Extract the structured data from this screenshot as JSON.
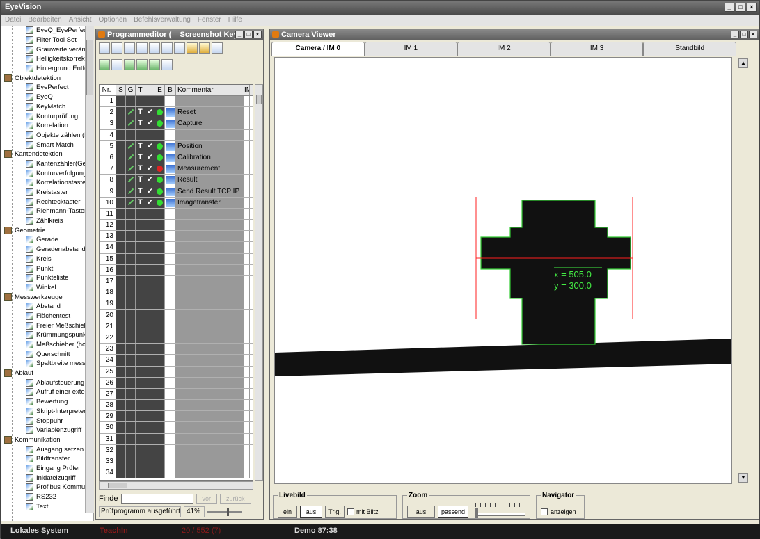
{
  "app": {
    "title": "EyeVision"
  },
  "menu": [
    "Datei",
    "Bearbeiten",
    "Ansicht",
    "Optionen",
    "Befehlsverwaltung",
    "Fenster",
    "Hilfe"
  ],
  "tree": [
    {
      "type": "item",
      "label": "EyeQ_EyePerfect"
    },
    {
      "type": "item",
      "label": "Filter Tool Set"
    },
    {
      "type": "item",
      "label": "Grauwerte veränd"
    },
    {
      "type": "item",
      "label": "Helligkeitskorrekt"
    },
    {
      "type": "item",
      "label": "Hintergrund Entfer"
    },
    {
      "type": "cat",
      "label": "Objektdetektion"
    },
    {
      "type": "item",
      "label": "EyePerfect"
    },
    {
      "type": "item",
      "label": "EyeQ"
    },
    {
      "type": "item",
      "label": "KeyMatch"
    },
    {
      "type": "item",
      "label": "Konturprüfung"
    },
    {
      "type": "item",
      "label": "Korrelation"
    },
    {
      "type": "item",
      "label": "Objekte zählen (B"
    },
    {
      "type": "item",
      "label": "Smart Match"
    },
    {
      "type": "cat",
      "label": "Kantendetektion"
    },
    {
      "type": "item",
      "label": "Kantenzähler(Gera"
    },
    {
      "type": "item",
      "label": "Konturverfolgung"
    },
    {
      "type": "item",
      "label": "Korrelationstaster"
    },
    {
      "type": "item",
      "label": "Kreistaster"
    },
    {
      "type": "item",
      "label": "Rechtecktaster"
    },
    {
      "type": "item",
      "label": "Riehmann-Taster"
    },
    {
      "type": "item",
      "label": "Zählkreis"
    },
    {
      "type": "cat",
      "label": "Geometrie"
    },
    {
      "type": "item",
      "label": "Gerade"
    },
    {
      "type": "item",
      "label": "Geradenabstand"
    },
    {
      "type": "item",
      "label": "Kreis"
    },
    {
      "type": "item",
      "label": "Punkt"
    },
    {
      "type": "item",
      "label": "Punkteliste"
    },
    {
      "type": "item",
      "label": "Winkel"
    },
    {
      "type": "cat",
      "label": "Messwerkzeuge"
    },
    {
      "type": "item",
      "label": "Abstand"
    },
    {
      "type": "item",
      "label": "Flächentest"
    },
    {
      "type": "item",
      "label": "Freier Meßschiebe"
    },
    {
      "type": "item",
      "label": "Krümmungspunkt"
    },
    {
      "type": "item",
      "label": "Meßschieber (hor."
    },
    {
      "type": "item",
      "label": "Querschnitt"
    },
    {
      "type": "item",
      "label": "Spaltbreite messe"
    },
    {
      "type": "cat",
      "label": "Ablauf"
    },
    {
      "type": "item",
      "label": "Ablaufsteuerung"
    },
    {
      "type": "item",
      "label": "Aufruf einer extern"
    },
    {
      "type": "item",
      "label": "Bewertung"
    },
    {
      "type": "item",
      "label": "Skript-Interpreter"
    },
    {
      "type": "item",
      "label": "Stoppuhr"
    },
    {
      "type": "item",
      "label": "Variablenzugriff"
    },
    {
      "type": "cat",
      "label": "Kommunikation"
    },
    {
      "type": "item",
      "label": "Ausgang setzen"
    },
    {
      "type": "item",
      "label": "Bildtransfer"
    },
    {
      "type": "item",
      "label": "Eingang Prüfen"
    },
    {
      "type": "item",
      "label": "Inidateizugriff"
    },
    {
      "type": "item",
      "label": "Profibus Kommuni"
    },
    {
      "type": "item",
      "label": "RS232"
    },
    {
      "type": "item",
      "label": "Text"
    }
  ],
  "program_editor": {
    "title": "Programmeditor (__Screenshot Key...",
    "columns": [
      "Nr.",
      "S",
      "G",
      "T",
      "I",
      "E",
      "B",
      "Kommentar",
      "IM"
    ],
    "rows": [
      {
        "nr": "1",
        "comment": "",
        "active": false,
        "status": ""
      },
      {
        "nr": "2",
        "comment": "Reset",
        "active": true,
        "status": "green"
      },
      {
        "nr": "3",
        "comment": "Capture",
        "active": true,
        "status": "green"
      },
      {
        "nr": "4",
        "comment": "",
        "active": false,
        "status": ""
      },
      {
        "nr": "5",
        "comment": "Position",
        "active": true,
        "status": "green"
      },
      {
        "nr": "6",
        "comment": "Calibration",
        "active": true,
        "status": "green"
      },
      {
        "nr": "7",
        "comment": "Measurement",
        "active": true,
        "status": "red"
      },
      {
        "nr": "8",
        "comment": "Result",
        "active": true,
        "status": "green"
      },
      {
        "nr": "9",
        "comment": "Send Result TCP IP",
        "active": true,
        "status": "green"
      },
      {
        "nr": "10",
        "comment": "Imagetransfer",
        "active": true,
        "status": "green"
      },
      {
        "nr": "11",
        "comment": "",
        "active": false,
        "status": ""
      },
      {
        "nr": "12",
        "comment": "",
        "active": false,
        "status": ""
      },
      {
        "nr": "13",
        "comment": "",
        "active": false,
        "status": ""
      },
      {
        "nr": "14",
        "comment": "",
        "active": false,
        "status": ""
      },
      {
        "nr": "15",
        "comment": "",
        "active": false,
        "status": ""
      },
      {
        "nr": "16",
        "comment": "",
        "active": false,
        "status": ""
      },
      {
        "nr": "17",
        "comment": "",
        "active": false,
        "status": ""
      },
      {
        "nr": "18",
        "comment": "",
        "active": false,
        "status": ""
      },
      {
        "nr": "19",
        "comment": "",
        "active": false,
        "status": ""
      },
      {
        "nr": "20",
        "comment": "",
        "active": false,
        "status": ""
      },
      {
        "nr": "21",
        "comment": "",
        "active": false,
        "status": ""
      },
      {
        "nr": "22",
        "comment": "",
        "active": false,
        "status": ""
      },
      {
        "nr": "23",
        "comment": "",
        "active": false,
        "status": ""
      },
      {
        "nr": "24",
        "comment": "",
        "active": false,
        "status": ""
      },
      {
        "nr": "25",
        "comment": "",
        "active": false,
        "status": ""
      },
      {
        "nr": "26",
        "comment": "",
        "active": false,
        "status": ""
      },
      {
        "nr": "27",
        "comment": "",
        "active": false,
        "status": ""
      },
      {
        "nr": "28",
        "comment": "",
        "active": false,
        "status": ""
      },
      {
        "nr": "29",
        "comment": "",
        "active": false,
        "status": ""
      },
      {
        "nr": "30",
        "comment": "",
        "active": false,
        "status": ""
      },
      {
        "nr": "31",
        "comment": "",
        "active": false,
        "status": ""
      },
      {
        "nr": "32",
        "comment": "",
        "active": false,
        "status": ""
      },
      {
        "nr": "33",
        "comment": "",
        "active": false,
        "status": ""
      },
      {
        "nr": "34",
        "comment": "",
        "active": false,
        "status": ""
      }
    ],
    "find_label": "Finde",
    "find_value": "",
    "btn_next": "vor",
    "btn_prev": "zurück",
    "status_text": "Prüfprogramm ausgeführt",
    "zoom_pct": "41%"
  },
  "camera_viewer": {
    "title": "Camera Viewer",
    "tabs": [
      "Camera / IM 0",
      "IM 1",
      "IM 2",
      "IM 3",
      "Standbild"
    ],
    "active_tab": 0,
    "overlay": {
      "x_text": "x = 505.0",
      "y_text": "y = 300.0"
    },
    "livebild": {
      "label": "Livebild",
      "btn_on": "ein",
      "btn_off": "aus",
      "btn_trig": "Trig.",
      "flash_label": "mit Blitz"
    },
    "zoom": {
      "label": "Zoom",
      "btn_off": "aus",
      "btn_fit": "passend"
    },
    "navigator": {
      "label": "Navigator",
      "show_label": "anzeigen"
    }
  },
  "taskbar": {
    "system": "Lokales System",
    "mode": "TeachIn",
    "counter": "20 / 552 (7)",
    "demo": "Demo 87:38"
  },
  "colors": {
    "accent_green": "#33dd33",
    "error_red": "#dd2222",
    "overlay_line_red": "#ff2020",
    "overlay_text_green": "#44ee44",
    "mode_red": "#8b1a1a"
  }
}
